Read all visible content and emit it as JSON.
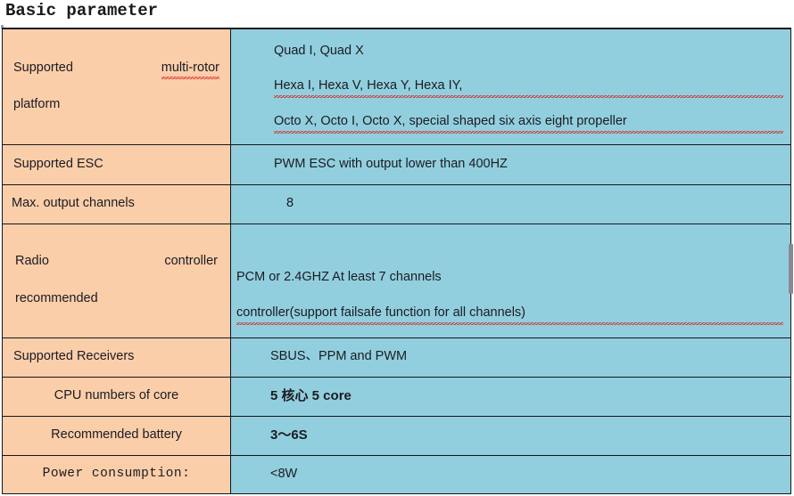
{
  "document": {
    "title": "Basic parameter"
  },
  "table": {
    "rows": [
      {
        "key_line1_left": "Supported",
        "key_line1_right": "multi-rotor",
        "key_line2": "platform",
        "values": [
          "Quad I, Quad X",
          "Hexa I, Hexa V, Hexa Y, Hexa IY,",
          "Octo X, Octo I, Octo X, special shaped six axis eight propeller"
        ]
      },
      {
        "key": "Supported ESC",
        "value": "PWM ESC with output lower than 400HZ"
      },
      {
        "key": "Max. output channels",
        "value": "8"
      },
      {
        "key_line1_left": "Radio",
        "key_line1_right": "controller",
        "key_line2": "recommended",
        "values": [
          "PCM or 2.4GHZ    At least 7 channels",
          "controller(support failsafe function for all channels)"
        ]
      },
      {
        "key": "Supported Receivers",
        "value": "SBUS、PPM and PWM"
      },
      {
        "key": "CPU numbers of core",
        "value": "5 核心  5 core"
      },
      {
        "key": "Recommended battery",
        "value": "3～6S"
      },
      {
        "key": "Power consumption:",
        "value": "<8W"
      }
    ]
  },
  "colors": {
    "key_cell_background": "#fbceaa",
    "value_cell_background": "#92cfde",
    "border": "#16161e",
    "text": "#1b1b22",
    "spellcheck_underline": "#d62222"
  }
}
